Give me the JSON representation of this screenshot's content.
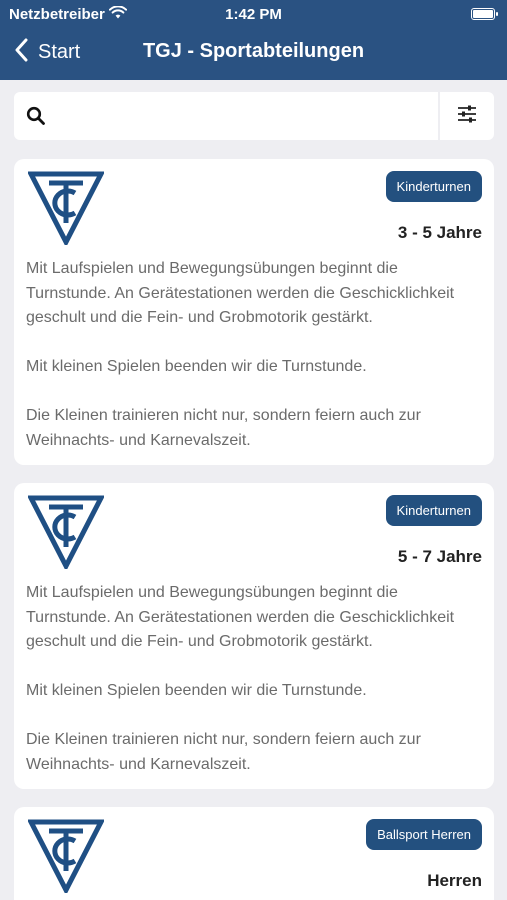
{
  "status": {
    "carrier": "Netzbetreiber",
    "time": "1:42 PM"
  },
  "nav": {
    "back_label": "Start",
    "title": "TGJ - Sportabteilungen"
  },
  "search": {
    "value": "",
    "placeholder": ""
  },
  "cards": [
    {
      "badge": "Kinderturnen",
      "age": "3 - 5 Jahre",
      "paragraphs": [
        "Mit Laufspielen und Bewegungsübungen beginnt die Turnstunde. An Gerätestationen werden die Geschicklichkeit geschult und die Fein- und Grobmotorik gestärkt.",
        "Mit kleinen Spielen beenden wir die Turnstunde.",
        "Die Kleinen trainieren nicht nur, sondern feiern auch zur Weihnachts- und Karnevalszeit."
      ]
    },
    {
      "badge": "Kinderturnen",
      "age": "5 - 7 Jahre",
      "paragraphs": [
        "Mit Laufspielen und Bewegungsübungen beginnt die Turnstunde. An Gerätestationen werden die Geschicklichkeit geschult und die Fein- und Grobmotorik gestärkt.",
        "Mit kleinen Spielen beenden wir die Turnstunde.",
        "Die Kleinen trainieren nicht nur, sondern feiern auch zur Weihnachts- und Karnevalszeit."
      ]
    },
    {
      "badge": "Ballsport Herren",
      "age": "Herren",
      "paragraphs": []
    }
  ],
  "colors": {
    "brand": "#2a5282",
    "badge": "#23507f",
    "logo": "#1f4f84"
  }
}
